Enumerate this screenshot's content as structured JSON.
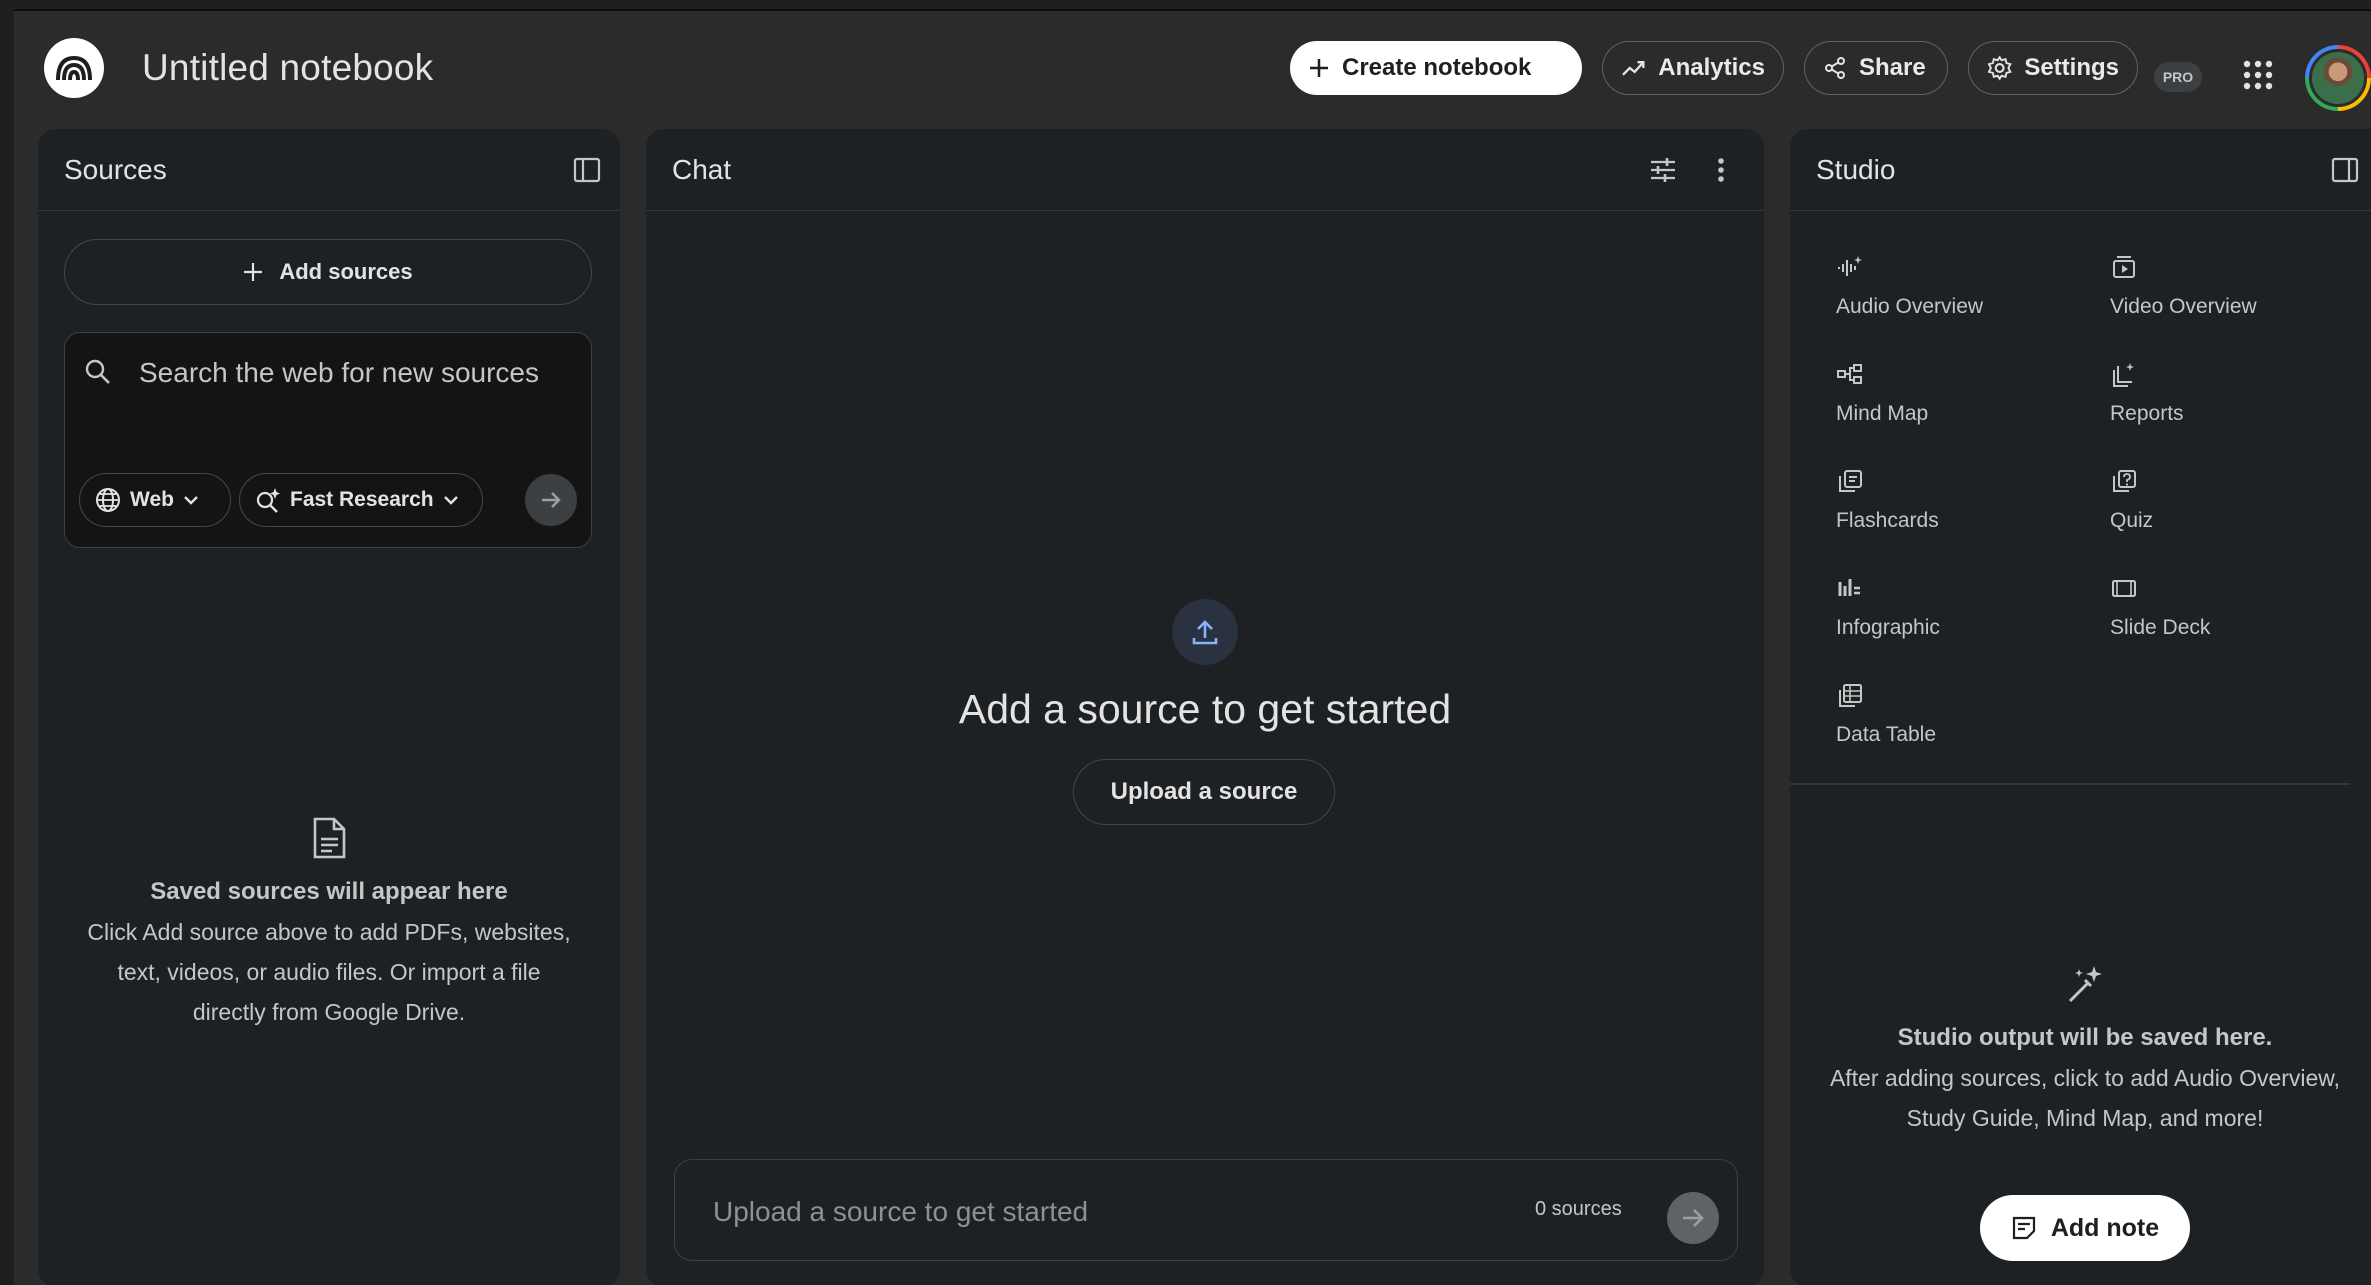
{
  "header": {
    "title": "Untitled notebook",
    "create_label": "Create notebook",
    "analytics_label": "Analytics",
    "share_label": "Share",
    "settings_label": "Settings",
    "pro_badge": "PRO"
  },
  "sources": {
    "title": "Sources",
    "add_label": "Add sources",
    "search_placeholder": "Search the web for new sources",
    "web_chip": "Web",
    "research_chip": "Fast Research",
    "empty_title": "Saved sources will appear here",
    "empty_line1": "Click Add source above to add PDFs, websites,",
    "empty_line2": "text, videos, or audio files. Or import a file",
    "empty_line3": "directly from Google Drive."
  },
  "chat": {
    "title": "Chat",
    "headline": "Add a source to get started",
    "upload_label": "Upload a source",
    "input_placeholder": "Upload a source to get started",
    "source_count": "0 sources"
  },
  "studio": {
    "title": "Studio",
    "tiles": [
      {
        "label": "Audio Overview",
        "icon": "audio-wave-icon"
      },
      {
        "label": "Video Overview",
        "icon": "video-icon"
      },
      {
        "label": "Mind Map",
        "icon": "mind-map-icon"
      },
      {
        "label": "Reports",
        "icon": "reports-icon"
      },
      {
        "label": "Flashcards",
        "icon": "flashcards-icon"
      },
      {
        "label": "Quiz",
        "icon": "quiz-icon"
      },
      {
        "label": "Infographic",
        "icon": "infographic-icon"
      },
      {
        "label": "Slide Deck",
        "icon": "slide-deck-icon"
      },
      {
        "label": "Data Table",
        "icon": "data-table-icon"
      }
    ],
    "empty_title": "Studio output will be saved here.",
    "empty_line1": "After adding sources, click to add Audio Overview,",
    "empty_line2": "Study Guide, Mind Map, and more!",
    "add_note_label": "Add note"
  },
  "colors": {
    "background": "#2b2b2b",
    "panel": "#1e2124",
    "accent_blue": "#8ab4f8"
  }
}
